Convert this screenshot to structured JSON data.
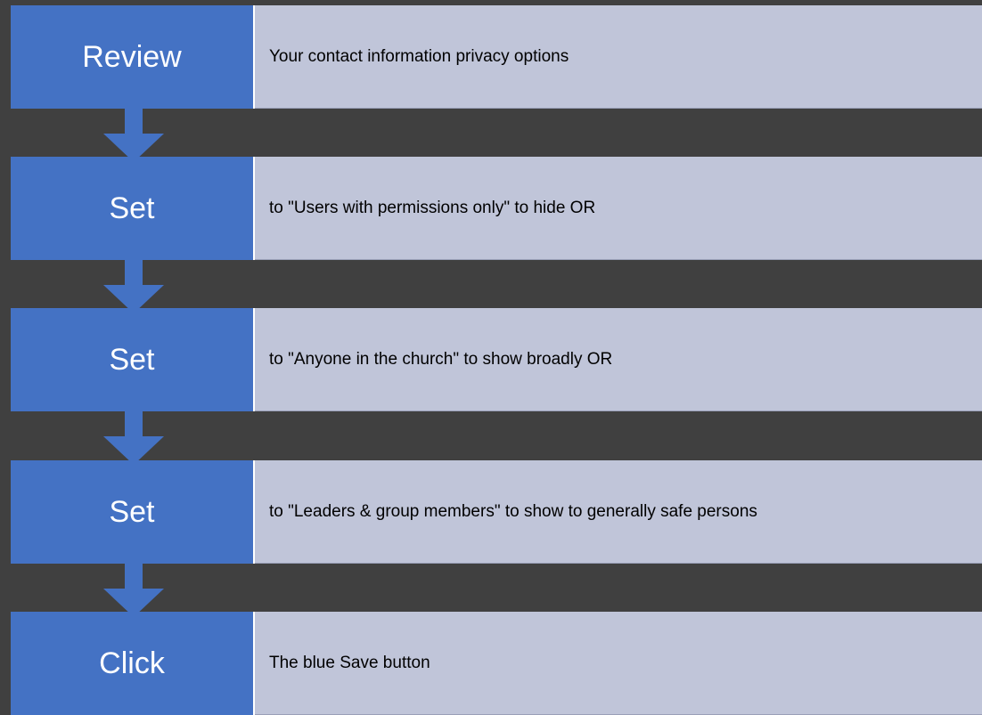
{
  "colors": {
    "background": "#404040",
    "step_label_fill": "#4472c4",
    "step_desc_fill": "#c0c5d9",
    "arrow_fill": "#4472c4"
  },
  "steps": [
    {
      "label": "Review",
      "description": "Your contact information privacy options"
    },
    {
      "label": "Set",
      "description": "to \"Users with permissions only\" to hide   OR"
    },
    {
      "label": "Set",
      "description": "to \"Anyone in the church\" to show broadly   OR"
    },
    {
      "label": "Set",
      "description": "to \"Leaders & group members\" to show to generally safe persons"
    },
    {
      "label": "Click",
      "description": "The blue Save button"
    }
  ]
}
